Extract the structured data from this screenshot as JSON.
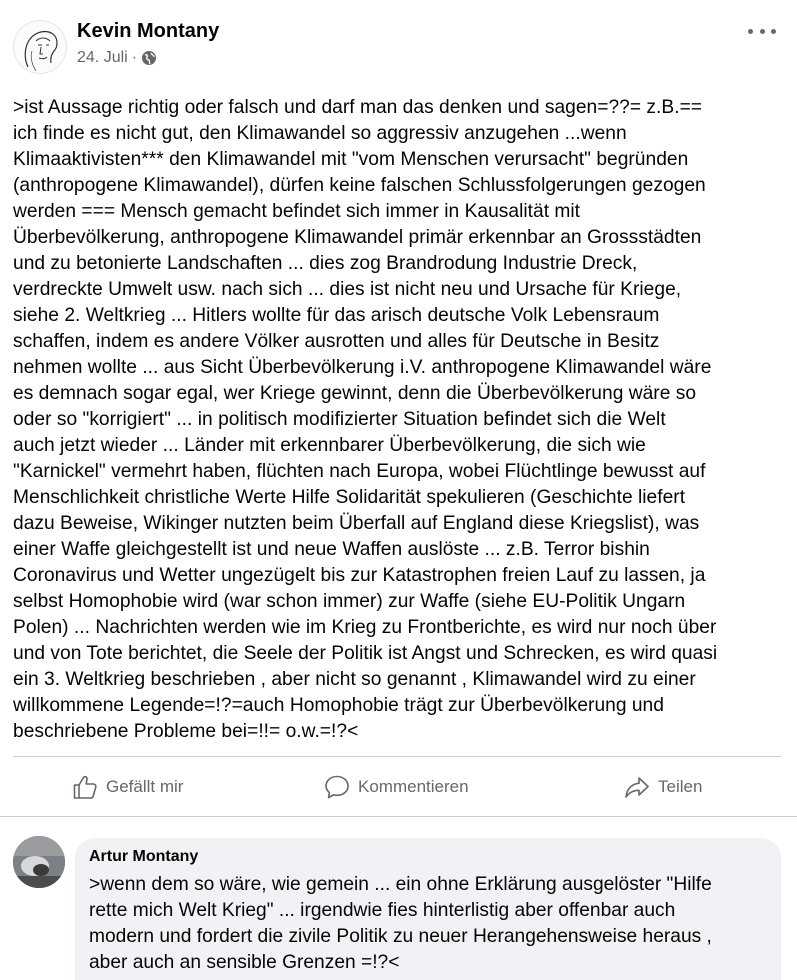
{
  "post": {
    "author": "Kevin Montany",
    "date": "24. Juli",
    "separator": "·",
    "privacy_icon": "globe-icon",
    "more_icon": "more-horizontal-icon",
    "text_lines": [
      ">ist Aussage richtig oder falsch und darf man das denken und sagen=??= z.B.==",
      "ich finde es nicht gut, den Klimawandel so aggressiv anzugehen ...wenn",
      "Klimaaktivisten*** den Klimawandel mit \"vom Menschen verursacht\" begründen",
      "(anthropogene Klimawandel), dürfen keine falschen Schlussfolgerungen gezogen",
      "werden === Mensch gemacht befindet sich immer in Kausalität mit",
      "Überbevölkerung, anthropogene Klimawandel primär erkennbar an Grossstädten",
      "und zu betonierte Landschaften ... dies zog Brandrodung Industrie Dreck,",
      "verdreckte Umwelt usw. nach sich ... dies ist nicht neu und Ursache für Kriege,",
      "siehe 2. Weltkrieg ... Hitlers wollte für das arisch deutsche Volk Lebensraum",
      "schaffen, indem es andere Völker ausrotten und alles für Deutsche in Besitz",
      "nehmen wollte ... aus Sicht Überbevölkerung i.V. anthropogene Klimawandel wäre",
      "es demnach sogar egal, wer Kriege gewinnt, denn die Überbevölkerung wäre so",
      "oder so \"korrigiert\" ... in politisch modifizierter Situation befindet sich die Welt",
      "auch jetzt wieder ... Länder mit erkennbarer Überbevölkerung, die sich wie",
      "\"Karnickel\" vermehrt haben, flüchten nach Europa, wobei Flüchtlinge bewusst auf",
      "Menschlichkeit christliche Werte Hilfe Solidarität spekulieren (Geschichte liefert",
      "dazu Beweise, Wikinger nutzten beim Überfall auf England diese Kriegslist), was",
      "einer Waffe gleichgestellt ist und neue Waffen auslöste ... z.B. Terror bishin",
      "Coronavirus und Wetter ungezügelt bis zur Katastrophen freien Lauf zu lassen, ja",
      "selbst Homophobie wird (war schon immer) zur Waffe (siehe EU-Politik Ungarn",
      "Polen) ... Nachrichten werden wie im Krieg zu Frontberichte, es wird nur noch über",
      "und von Tote berichtet, die Seele der Politik ist Angst und Schrecken, es wird quasi",
      "ein 3. Weltkrieg beschrieben , aber nicht so genannt , Klimawandel wird zu einer",
      "willkommene Legende=!?=auch Homophobie trägt zur Überbevölkerung und",
      "beschriebene Probleme bei=!!= o.w.=!?<"
    ]
  },
  "actions": {
    "like_label": "Gefällt mir",
    "comment_label": "Kommentieren",
    "share_label": "Teilen",
    "like_icon": "thumbs-up-icon",
    "comment_icon": "comment-icon",
    "share_icon": "share-icon"
  },
  "comment": {
    "author": "Artur Montany",
    "text_lines": [
      ">wenn dem so wäre, wie gemein ... ein ohne Erklärung ausgelöster \"Hilfe",
      "rette mich Welt Krieg\" ... irgendwie fies hinterlistig aber offenbar auch",
      "modern und fordert die zivile Politik zu neuer Herangehensweise heraus ,",
      "aber auch an sensible Grenzen  =!?<"
    ]
  },
  "colors": {
    "text_primary": "#050505",
    "text_secondary": "#65676b",
    "divider": "#ced0d4",
    "comment_bubble": "#f0f2f5"
  }
}
